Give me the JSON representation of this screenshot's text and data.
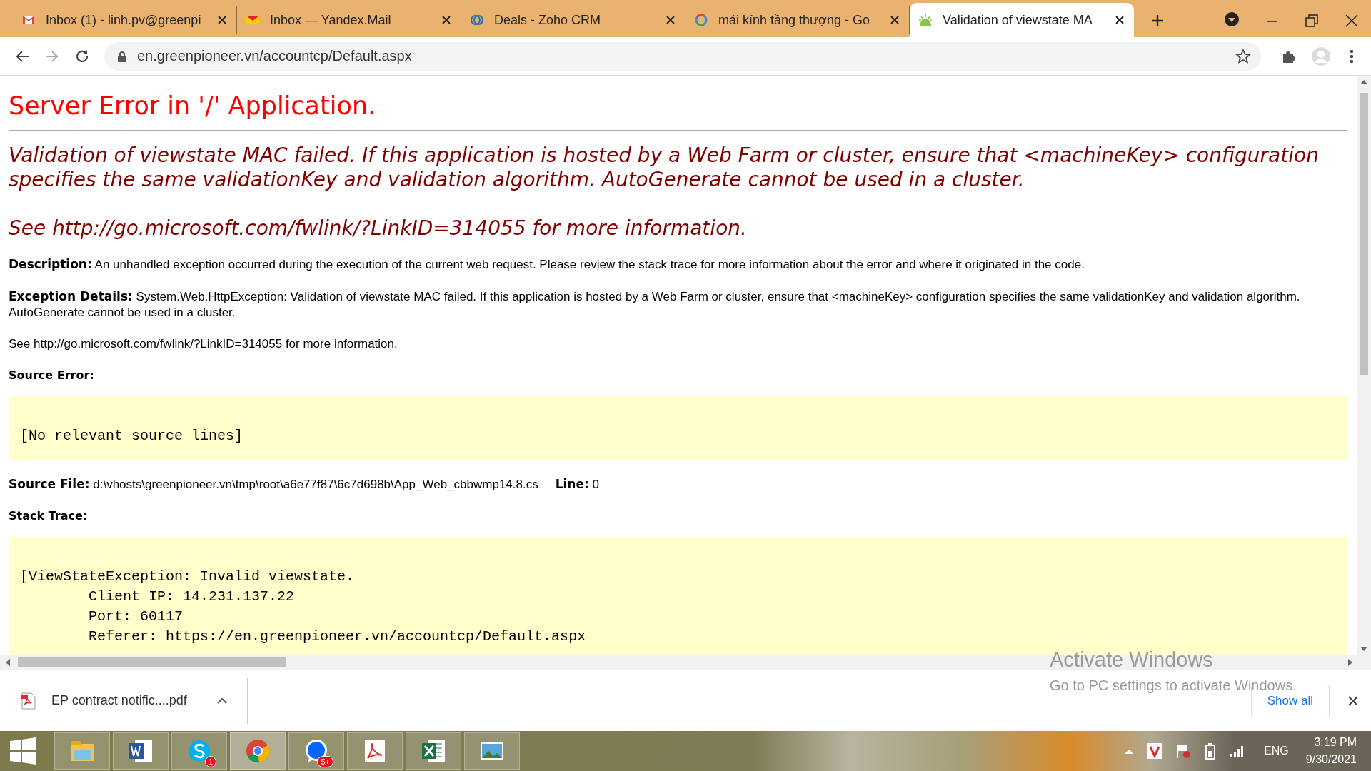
{
  "browser": {
    "tabs": [
      {
        "title": "Inbox (1) - linh.pv@greenpi",
        "kind": "gmail",
        "selected": false
      },
      {
        "title": "Inbox — Yandex.Mail",
        "kind": "yandex",
        "selected": false
      },
      {
        "title": "Deals - Zoho CRM",
        "kind": "zoho",
        "selected": false
      },
      {
        "title": "mái kính tầng thượng - Go",
        "kind": "google",
        "selected": false
      },
      {
        "title": "Validation of viewstate MA",
        "kind": "sun",
        "selected": true
      }
    ],
    "address": "en.greenpioneer.vn/accountcp/Default.aspx"
  },
  "page": {
    "heading": "Server Error in '/' Application.",
    "message": "Validation of viewstate MAC failed. If this application is hosted by a Web Farm or cluster, ensure that <machineKey> configuration specifies the same validationKey and validation algorithm. AutoGenerate cannot be used in a cluster.",
    "more_info": "See http://go.microsoft.com/fwlink/?LinkID=314055 for more information.",
    "blocks": [
      {
        "kind": "para",
        "text": "**Description:** An unhandled exception occurred during the execution of the current web request. Please review the stack trace for more information about the error and where it originated in the code."
      },
      {
        "kind": "para",
        "text": "**Exception Details:** System.Web.HttpException: Validation of viewstate MAC failed. If this application is hosted by a Web Farm or cluster, ensure that <machineKey> configuration specifies the same validationKey and validation algorithm. AutoGenerate cannot be used in a cluster."
      },
      {
        "kind": "para",
        "text": "See http://go.microsoft.com/fwlink/?LinkID=314055 for more information."
      },
      {
        "kind": "heading",
        "text": "Source Error:"
      },
      {
        "kind": "code",
        "lines": [
          "[No relevant source lines]"
        ]
      },
      {
        "kind": "pair",
        "items": [
          "**Source File:** d:\\vhosts\\greenpioneer.vn\\tmp\\root\\a6e77f87\\6c7d698b\\App_Web_cbbwmp14.8.cs",
          "**Line:** 0"
        ]
      },
      {
        "kind": "heading",
        "text": "Stack Trace:"
      },
      {
        "kind": "code",
        "lines": [
          "[ViewStateException: Invalid viewstate.",
          "\tClient IP: 14.231.137.22",
          "\tPort: 60117",
          "\tReferer: https://en.greenpioneer.vn/accountcp/Default.aspx"
        ]
      }
    ]
  },
  "activation": {
    "title": "Activate Windows",
    "hint": "Go to PC settings to activate Windows."
  },
  "downloads": {
    "file": "EP contract notific....pdf",
    "show_all": "Show all"
  },
  "taskbar": {
    "apps": [
      {
        "kind": "explorer",
        "active": false
      },
      {
        "kind": "word",
        "active": false
      },
      {
        "kind": "skype",
        "active": false,
        "badge": "1"
      },
      {
        "kind": "chrome",
        "active": true
      },
      {
        "kind": "zalo",
        "active": false,
        "badge": "5+"
      },
      {
        "kind": "acrobat",
        "active": false
      },
      {
        "kind": "excel",
        "active": false
      },
      {
        "kind": "photos",
        "active": false
      }
    ],
    "language": "ENG",
    "time": "3:19 PM",
    "date": "9/30/2021"
  }
}
